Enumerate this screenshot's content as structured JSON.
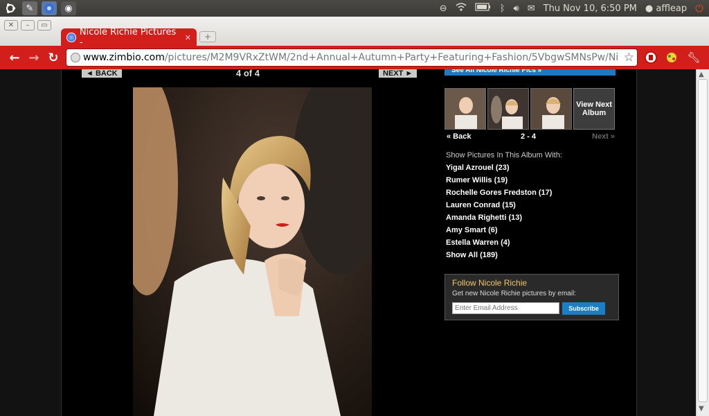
{
  "system_panel": {
    "clock": "Thu Nov 10,  6:50 PM",
    "user": "affleap"
  },
  "browser": {
    "tab_title": "Nicole Richie Pictures -",
    "url_domain": "www.zimbio.com",
    "url_path": "/pictures/M2M9VRxZtWM/2nd+Annual+Autumn+Party+Featuring+Fashion/5VbgwSMNsPw/Ni"
  },
  "gallery": {
    "back_label": "◄ BACK",
    "next_label": "NEXT ►",
    "counter": "4  of  4"
  },
  "sidebar": {
    "see_all": "See All Nicole Richie Pics »",
    "view_next_album": "View Next Album",
    "thumb_back": "« Back",
    "thumb_range": "2 - 4",
    "thumb_next": "Next »",
    "show_with_heading": "Show Pictures In This Album With:",
    "filters": [
      "Yigal Azrouel (23)",
      "Rumer Willis (19)",
      "Rochelle Gores Fredston (17)",
      "Lauren Conrad (15)",
      "Amanda Righetti (13)",
      "Amy Smart (6)",
      "Estella Warren (4)",
      "Show All (189)"
    ],
    "follow": {
      "title": "Follow Nicole Richie",
      "subtitle": "Get new Nicole Richie pictures by email:",
      "email_placeholder": "Enter Email Address",
      "subscribe_label": "Subscribe"
    }
  },
  "colors": {
    "chrome_red": "#d21f1c",
    "subscribe_blue": "#1b7fc6",
    "follow_title": "#f0c869"
  }
}
